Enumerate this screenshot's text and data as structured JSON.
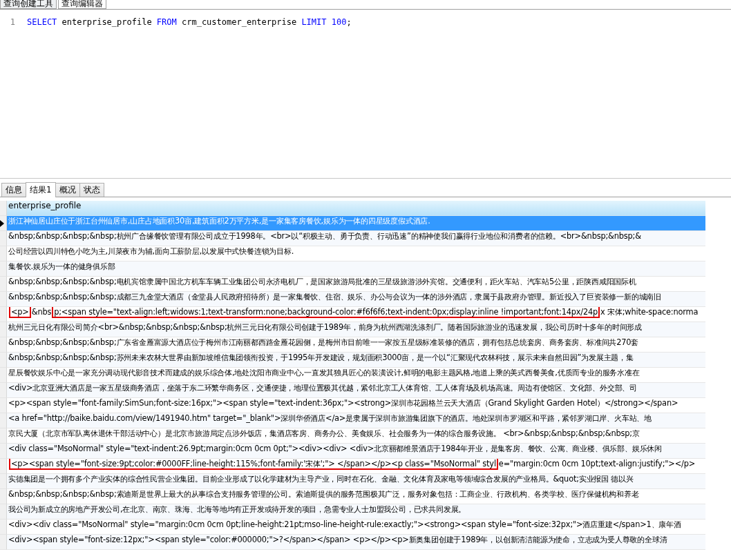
{
  "window_tabs": [
    {
      "label": "查询创建工具",
      "selected": false
    },
    {
      "label": "查询编辑器",
      "selected": true
    }
  ],
  "editor": {
    "lines": [
      {
        "number": "1",
        "tokens": [
          {
            "text": "SELECT",
            "kind": "keyword"
          },
          {
            "text": " enterprise_profile ",
            "kind": "identifier"
          },
          {
            "text": "FROM",
            "kind": "keyword"
          },
          {
            "text": " crm_customer_enterprise ",
            "kind": "identifier"
          },
          {
            "text": "LIMIT",
            "kind": "keyword"
          },
          {
            "text": " 100",
            "kind": "number"
          },
          {
            "text": ";",
            "kind": "identifier"
          }
        ]
      }
    ]
  },
  "result_tabs": [
    {
      "label": "信息",
      "selected": false
    },
    {
      "label": "结果1",
      "selected": true
    },
    {
      "label": "概况",
      "selected": false
    },
    {
      "label": "状态",
      "selected": false
    }
  ],
  "table": {
    "columns": [
      "enterprise_profile"
    ],
    "rows": [
      {
        "selected": true,
        "text": "浙江神仙居山庄位于浙江台州仙居市,山庄占地面积30亩,建筑面积2万平方米,是一家集客房餐饮,娱乐为一体的四星级度假式酒店."
      },
      {
        "selected": false,
        "text": "&nbsp;&nbsp;&nbsp;&nbsp;杭州广合缘餐饮管理有限公司成立于1998年。<br>以“积极主动、勇于负责、行动迅速”的精神使我们赢得行业地位和消费者的信赖。<br>&nbsp;&nbsp;&"
      },
      {
        "selected": false,
        "text": "公司经营以四川特色小吃为主,川菜夜市为辅,面向工薪阶层,以发展中式快餐连锁为目标."
      },
      {
        "selected": false,
        "text": "集餐饮.娱乐为一体的健身俱乐部"
      },
      {
        "selected": false,
        "text": "&nbsp;&nbsp;&nbsp;&nbsp;电机宾馆隶属中国北方机车车辆工业集团公司永济电机厂，是国家旅游局批准的三星级旅游涉外宾馆。交通便利，距火车站、汽车站5公里，距陕西咸阳国际机"
      },
      {
        "selected": false,
        "text": "&nbsp;&nbsp;&nbsp;&nbsp;成都三九金堂大酒店（金堂县人民政府招待所）是一家集餐饮、住宿、娱乐、办公与会议为一体的涉外酒店，隶属于县政府办管理。新近投入了巨资装修一新的城南旧"
      },
      {
        "selected": false,
        "segments": [
          {
            "text": "<p>",
            "marked": true
          },
          {
            "text": "&nbs",
            "marked": false
          },
          {
            "text": "p;<span style=\"text-align:left;widows:1;text-transform:none;background-color:#f6f6f6;text-indent:0px;display:inline !important;font:14px/24p",
            "marked": true
          },
          {
            "text": "x 宋体;white-space:norma",
            "marked": false
          }
        ]
      },
      {
        "selected": false,
        "text": "杭州三元日化有限公司简介<br>&nbsp;&nbsp;&nbsp;&nbsp;杭州三元日化有限公司创建于1989年，前身为杭州西湖洗涤剂厂。随着国际旅游业的迅速发展，我公司历时十多年的时间形成"
      },
      {
        "selected": false,
        "text": "&nbsp;&nbsp;&nbsp;&nbsp;广东省金雁富源大酒店位于梅州市江南丽都西路金雁花园侧，是梅州市目前唯一一家按五星级标准装修的酒店，拥有包括总统套房、商务套房、标准间共270套"
      },
      {
        "selected": false,
        "text": "&nbsp;&nbsp;&nbsp;&nbsp;苏州未来农林大世界由新加坡维信集团领衔投资，于1995年开发建设，规划面积3000亩，是一个以“汇聚现代农林科技，展示未来自然田园”为发展主题，集"
      },
      {
        "selected": false,
        "text": "星辰餐饮娱乐中心是一家充分调动现代影音技术而建成的娱乐综合体,地处沈阳市商业中心,一直发其独具匠心的装潢设计,鲜明的电影主题风格,地道上乘的美式西餐美食,优质而专业的服务水准在"
      },
      {
        "selected": false,
        "text": "<div>北京亚洲大酒店是一家五星级商务酒店，坐落于东二环繁华商务区，交通便捷，地理位置极其优越，紧邻北京工人体育馆、工人体育场及机场高速。周边有使馆区、文化部、外交部、司"
      },
      {
        "selected": false,
        "text": "<p><span style=\"font-family:SimSun;font-size:16px;\"><span style=\"text-indent:36px;\"><strong>深圳市花园格兰云天大酒店（Grand Skylight Garden Hotel）</strong></span>"
      },
      {
        "selected": false,
        "text": "<a href=\"http://baike.baidu.com/view/1491940.htm\" target=\"_blank\">深圳华侨酒店</a>是隶属于深圳市旅游集团旗下的酒店。地处深圳市罗湖区和平路，紧邻罗湖口岸、火车站、地"
      },
      {
        "selected": false,
        "text": "京民大厦（北京市军队离休退休干部活动中心）是北京市旅游局定点涉外饭店，集酒店客房、商务办公、美食娱乐、社会服务为一体的综合服务设施。 <br>&nbsp;&nbsp;&nbsp;&nbsp;京"
      },
      {
        "selected": false,
        "text": "<div class=\"MsoNormal\" style=\"text-indent:26.9pt;margin:0cm 0cm 0pt;\"><div><div> <div>北京丽都维景酒店于1984年开业，是集客房、餐饮、公寓、商业楼、俱乐部、娱乐休闲"
      },
      {
        "selected": false,
        "segments": [
          {
            "text": "<p><span style=\"font-size:9pt;color:#0000FF;line-height:115%;font-family:'宋体';\"> </span></p><p class=\"MsoNormal\" styl",
            "marked": true
          },
          {
            "text": "e=\"margin:0cm 0cm 10pt;text-align:justify;\"></p>",
            "marked": false
          }
        ]
      },
      {
        "selected": false,
        "text": "实德集团是一个拥有多个产业实体的综合性民营企业集团。目前企业形成了以化学建材为主导产业，同时在石化、金融、文化体育及家电等领域综合发展的产业格局。&quot;实业报国 德以兴"
      },
      {
        "selected": false,
        "text": "&nbsp;&nbsp;&nbsp;&nbsp;索迪斯是世界上最大的从事综合支持服务管理的公司。索迪斯提供的服务范围极其广泛，服务对象包括：工商企业、行政机构、各类学校、医疗保健机构和养老"
      },
      {
        "selected": false,
        "text": "我公司为新成立的房地产开发公司,在北京、南京、珠海、北海等地均有正开发或待开发的项目，急需专业人士加盟我公司，已求共同发展。"
      },
      {
        "selected": false,
        "text": "<div><div class=\"MsoNormal\" style=\"margin:0cm 0cm 0pt;line-height:21pt;mso-line-height-rule:exactly;\"><strong><span style=\"font-size:32px;\">酒店重建</span>1、康年酒"
      },
      {
        "selected": false,
        "text": "<div><span style=\"font-size:12px;\"><span style=\"color:#000000;\">?</span></span> <p></p><p>新奥集团创建于1989年，以创新清洁能源为使命，立志成为受人尊敬的全球清"
      }
    ]
  }
}
